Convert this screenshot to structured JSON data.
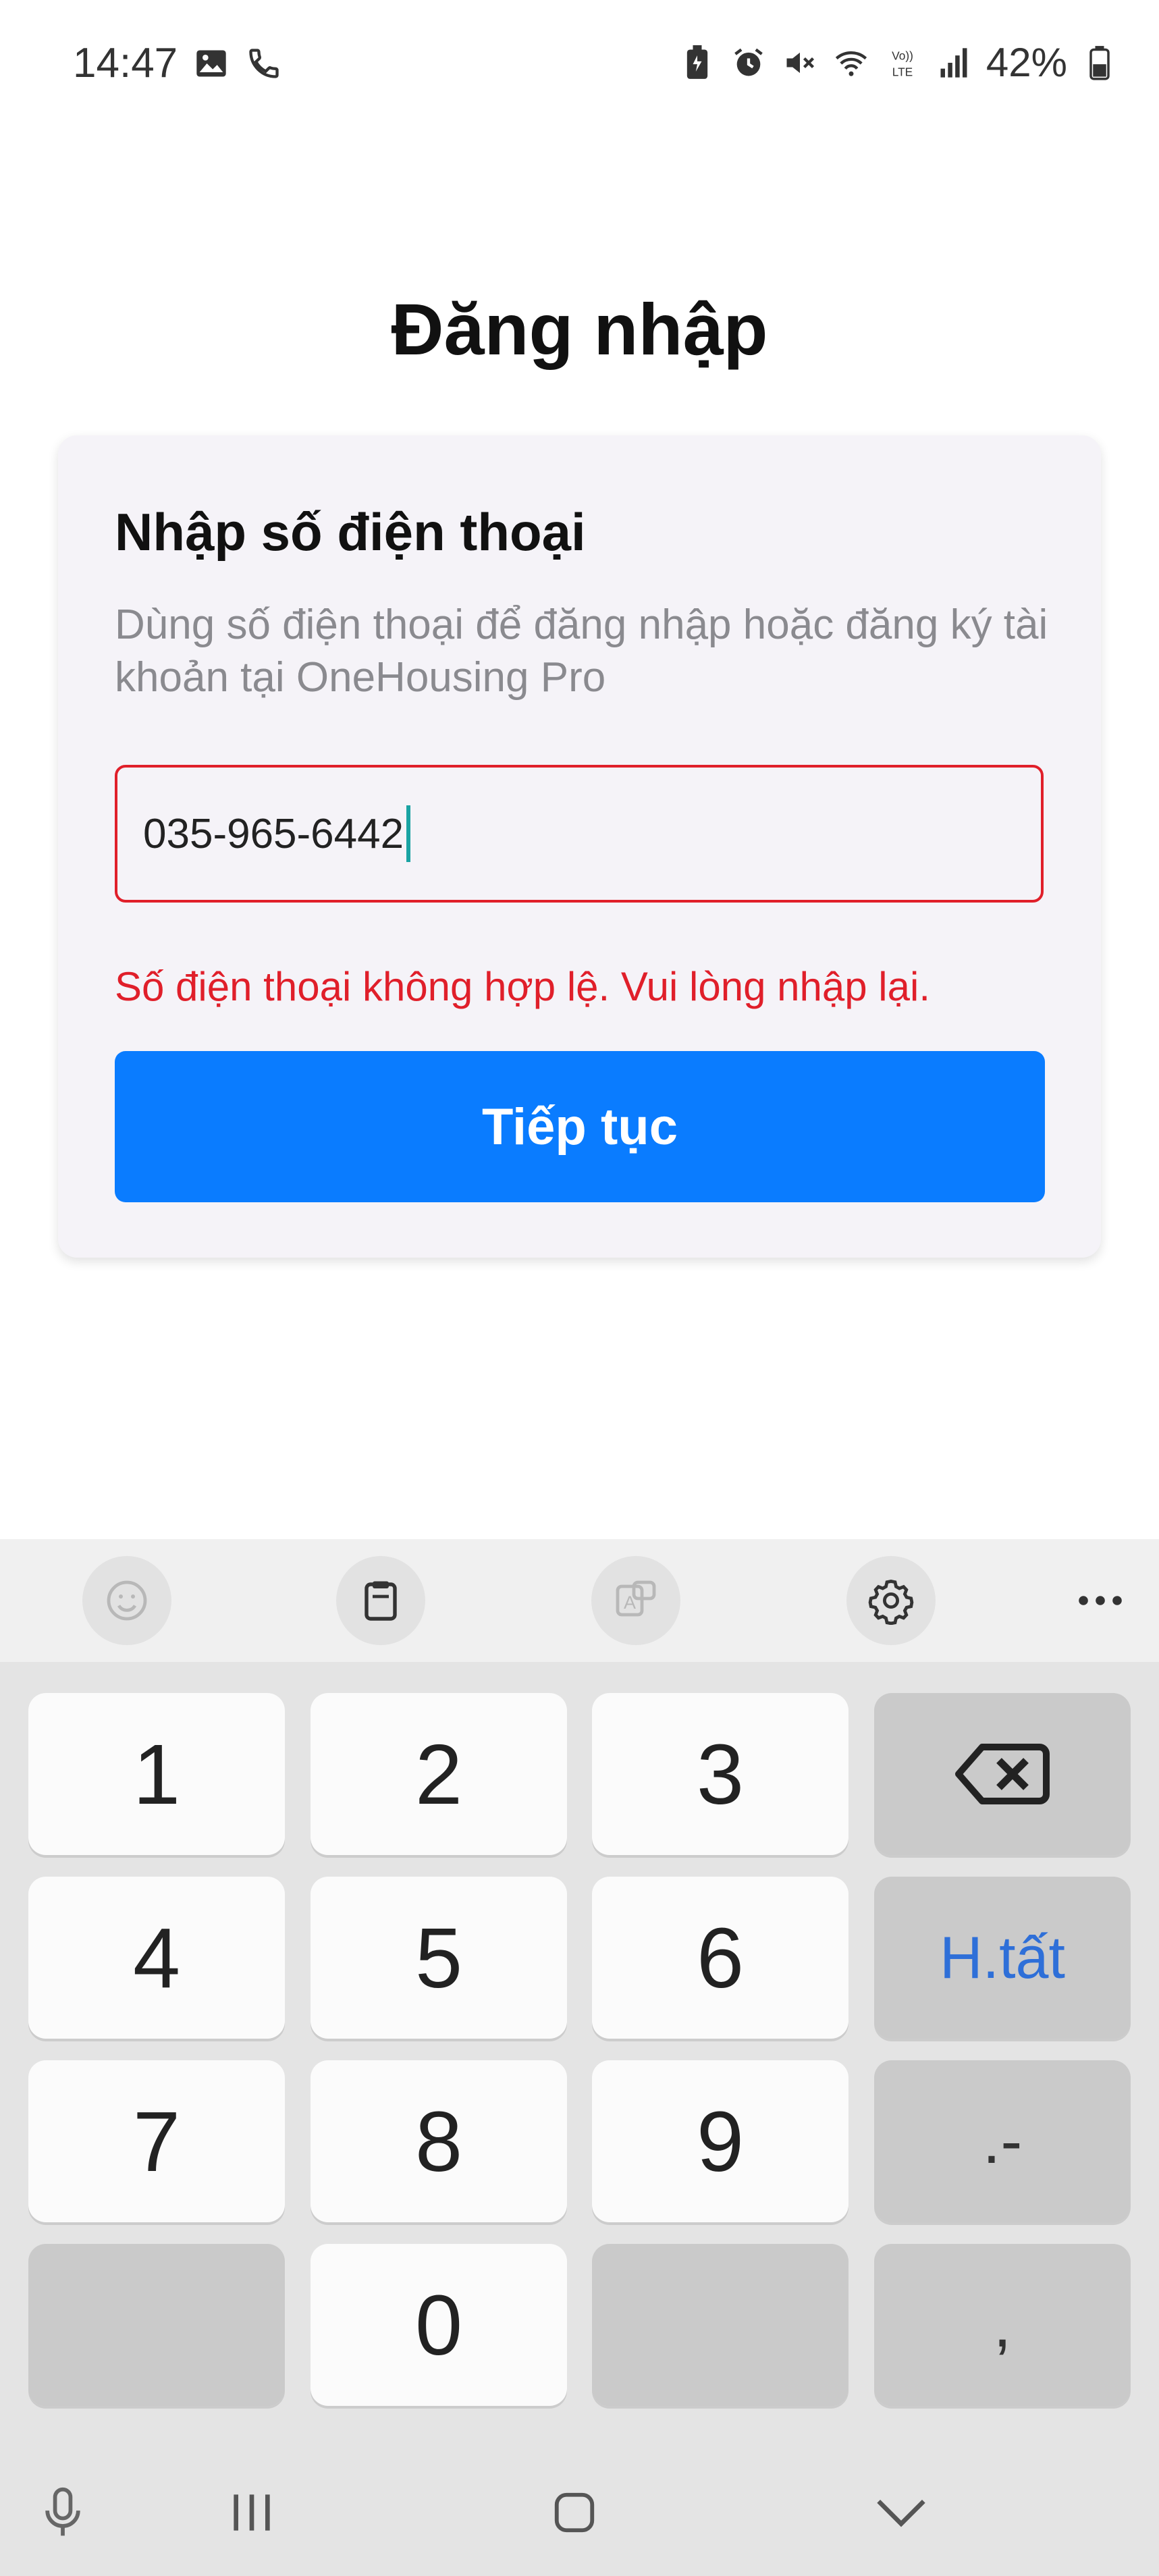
{
  "status_bar": {
    "time": "14:47",
    "battery_percent": "42%",
    "left_icons": [
      "image-icon",
      "phone-icon"
    ],
    "right_icons": [
      "battery-saver-icon",
      "alarm-icon",
      "mute-icon",
      "wifi-icon",
      "volte-icon",
      "signal-icon",
      "battery-icon"
    ],
    "volte_label": "VoLTE"
  },
  "header": {
    "title": "Đăng nhập"
  },
  "login_card": {
    "title": "Nhập số điện thoại",
    "description": "Dùng số điện thoại để đăng nhập hoặc đăng ký tài khoản tại OneHousing Pro",
    "phone_input": {
      "value": "035-965-6442",
      "state": "error"
    },
    "error_message": "Số điện thoại không hợp lệ. Vui lòng nhập lại.",
    "continue_button": "Tiếp tục"
  },
  "keyboard_toolbar": {
    "items": [
      "emoji-icon",
      "clipboard-icon",
      "text-edit-icon",
      "settings-icon",
      "more-icon"
    ]
  },
  "keypad": {
    "keys": {
      "k1": "1",
      "k2": "2",
      "k3": "3",
      "k4": "4",
      "k5": "5",
      "k6": "6",
      "k7": "7",
      "k8": "8",
      "k9": "9",
      "k0": "0",
      "done": "H.tất",
      "dot_dash": ".-",
      "comma": ","
    }
  },
  "nav_bar": {
    "items": [
      "microphone-icon",
      "recent-apps-icon",
      "home-icon",
      "hide-keyboard-icon"
    ]
  },
  "colors": {
    "accent": "#0a7cff",
    "error": "#e01f2a",
    "card_background": "#f5f3f8",
    "keyboard_background": "#e4e4e4",
    "done_key_text": "#2e6fd8",
    "caret": "#1aa3a3"
  }
}
